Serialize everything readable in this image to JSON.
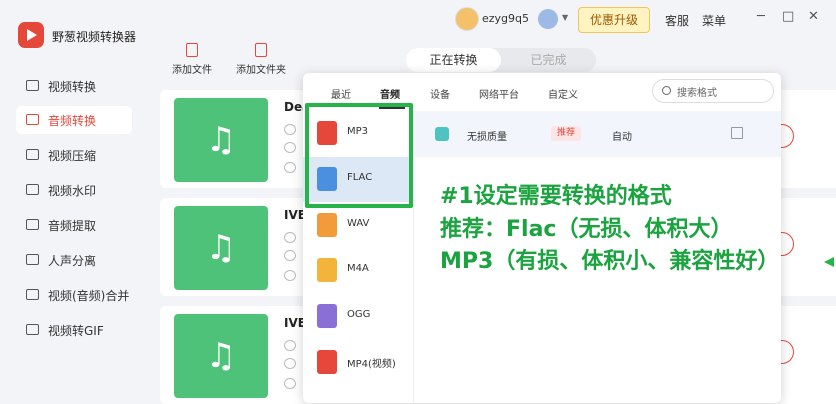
{
  "app": {
    "name": "野葱视频转换器"
  },
  "header": {
    "username": "ezyg9q5",
    "upgrade_label": "优惠升级",
    "service_label": "客服",
    "menu_label": "菜单",
    "minimize": "─",
    "maximize": "□",
    "close": "✕"
  },
  "sidebar": {
    "items": [
      {
        "label": "视频转换"
      },
      {
        "label": "音频转换"
      },
      {
        "label": "视频压缩"
      },
      {
        "label": "视频水印"
      },
      {
        "label": "音频提取"
      },
      {
        "label": "人声分离"
      },
      {
        "label": "视频(音频)合并"
      },
      {
        "label": "视频转GIF"
      }
    ]
  },
  "toolbar": {
    "add_file": "添加文件",
    "add_folder": "添加文件夹"
  },
  "tabs": {
    "converting": "正在转换",
    "completed": "已完成"
  },
  "files": [
    {
      "name": "Dea",
      "icon": "music-note-icon"
    },
    {
      "name": "IVE",
      "icon": "music-note-icon"
    },
    {
      "name": "IVE",
      "icon": "music-note-icon"
    }
  ],
  "format_panel": {
    "tabs": [
      "最近",
      "音频",
      "设备",
      "网络平台",
      "自定义"
    ],
    "search_placeholder": "搜索格式",
    "formats": [
      {
        "label": "MP3",
        "color": "#e5483b"
      },
      {
        "label": "FLAC",
        "color": "#4a8fe0"
      },
      {
        "label": "WAV",
        "color": "#f29b3a"
      },
      {
        "label": "M4A",
        "color": "#f2b43a"
      },
      {
        "label": "OGG",
        "color": "#8a6fd6"
      },
      {
        "label": "MP4(视频)",
        "color": "#e5483b"
      }
    ],
    "quality": {
      "name": "无损质量",
      "badge": "推荐",
      "value": "自动"
    }
  },
  "annotation": {
    "line1": "#1设定需要转换的格式",
    "line2": "推荐：Flac（无损、体积大）",
    "line3": "MP3（有损、体积小、兼容性好）"
  }
}
